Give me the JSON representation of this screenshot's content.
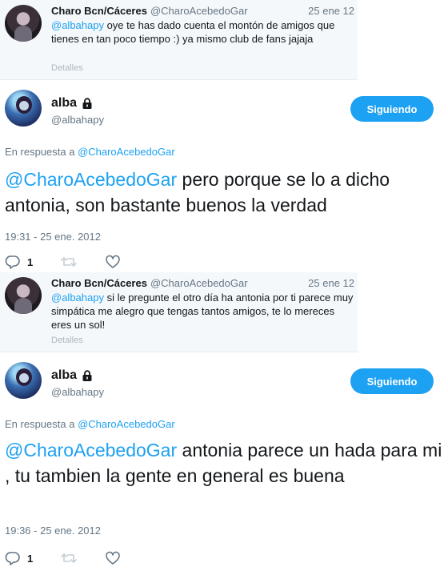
{
  "quoted": [
    {
      "name": "Charo Bcn/Cáceres",
      "handle": "@CharoAcebedoGar",
      "date": "25 ene 12",
      "mention": "@albahapy",
      "text": " oye te has dado cuenta el montón de amigos que tienes en tan poco tiempo :) ya mismo club de fans jajaja",
      "details": "Detalles"
    },
    {
      "name": "Charo Bcn/Cáceres",
      "handle": "@CharoAcebedoGar",
      "date": "25 ene 12",
      "mention": "@albahapy",
      "text": " si le pregunte el otro día ha antonia por ti parece muy simpática me alegro que tengas tantos amigos, te lo mereces eres un sol!",
      "details": "Detalles"
    }
  ],
  "tweets": [
    {
      "name": "alba",
      "handle": "@albahapy",
      "follow_label": "Siguiendo",
      "reply_prefix": "En respuesta a ",
      "reply_mention": "@CharoAcebedoGar",
      "mention": "@CharoAcebedoGar",
      "text": " pero porque se lo a dicho antonia, son bastante buenos la verdad",
      "timestamp": "19:31 - 25 ene. 2012",
      "replies": "1"
    },
    {
      "name": "alba",
      "handle": "@albahapy",
      "follow_label": "Siguiendo",
      "reply_prefix": "En respuesta a ",
      "reply_mention": "@CharoAcebedoGar",
      "mention": "@CharoAcebedoGar",
      "text": " antonia parece un hada para mi , tu tambien la gente en general es buena",
      "timestamp": "19:36 - 25 ene. 2012",
      "replies": "1"
    }
  ],
  "icons": {
    "lock": "lock-icon",
    "reply": "reply-icon",
    "retweet": "retweet-icon",
    "like": "heart-icon"
  },
  "colors": {
    "accent": "#1da1f2",
    "muted": "#657786",
    "quoted_bg": "#f5f8fa"
  }
}
